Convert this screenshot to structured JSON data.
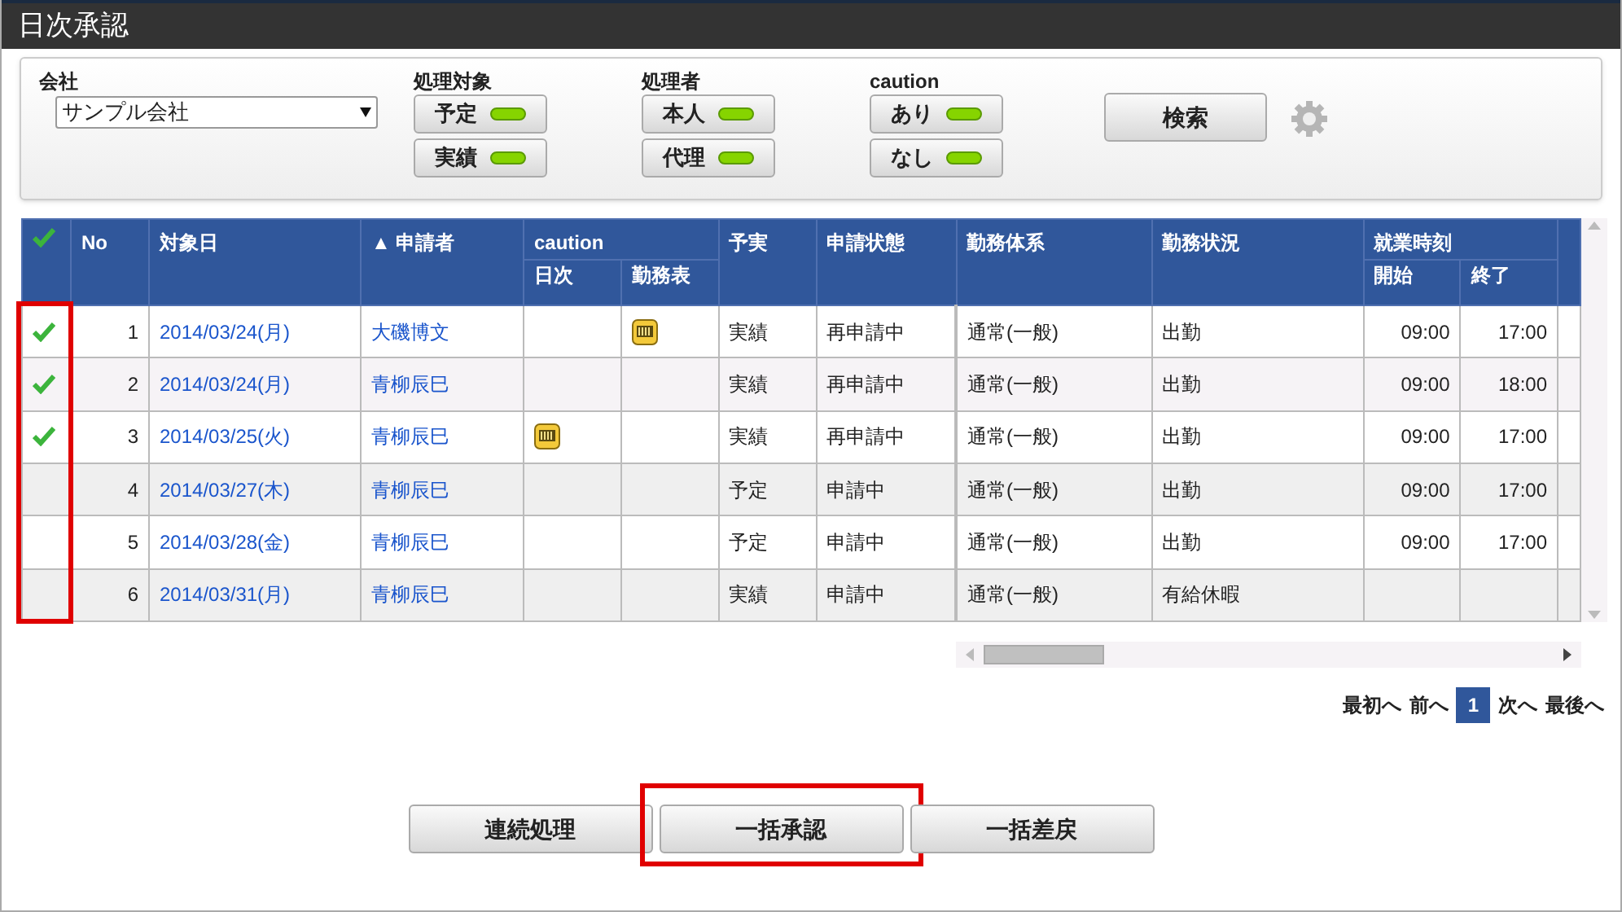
{
  "window": {
    "title": "日次承認"
  },
  "filters": {
    "company": {
      "label": "会社",
      "value": "サンプル会社"
    },
    "groups": [
      {
        "label": "処理対象",
        "toggles": [
          {
            "label": "予定",
            "on": true
          },
          {
            "label": "実績",
            "on": true
          }
        ]
      },
      {
        "label": "処理者",
        "toggles": [
          {
            "label": "本人",
            "on": true
          },
          {
            "label": "代理",
            "on": true
          }
        ]
      },
      {
        "label": "caution",
        "toggles": [
          {
            "label": "あり",
            "on": true
          },
          {
            "label": "なし",
            "on": true
          }
        ]
      }
    ],
    "search_button": "検索"
  },
  "table": {
    "select_column_highlighted": true,
    "columns": {
      "no": "No",
      "date": "対象日",
      "sort_mark": "▲",
      "applicant": "申請者",
      "caution": "caution",
      "caution_daily": "日次",
      "caution_sheet": "勤務表",
      "plan_actual": "予実",
      "status": "申請状態",
      "work_system": "勤務体系",
      "work_state": "勤務状況",
      "work_time": "就業時刻",
      "start": "開始",
      "end": "終了"
    },
    "rows": [
      {
        "checked": true,
        "no": "1",
        "date": "2014/03/24(月)",
        "applicant": "大磯博文",
        "daily_caution": false,
        "sheet_caution": true,
        "plan_actual": "実績",
        "status": "再申請中",
        "work_system": "通常(一般)",
        "work_state": "出勤",
        "start": "09:00",
        "end": "17:00"
      },
      {
        "checked": true,
        "no": "2",
        "date": "2014/03/24(月)",
        "applicant": "青柳辰巳",
        "daily_caution": false,
        "sheet_caution": false,
        "plan_actual": "実績",
        "status": "再申請中",
        "work_system": "通常(一般)",
        "work_state": "出勤",
        "start": "09:00",
        "end": "18:00"
      },
      {
        "checked": true,
        "no": "3",
        "date": "2014/03/25(火)",
        "applicant": "青柳辰巳",
        "daily_caution": true,
        "sheet_caution": false,
        "plan_actual": "実績",
        "status": "再申請中",
        "work_system": "通常(一般)",
        "work_state": "出勤",
        "start": "09:00",
        "end": "17:00"
      },
      {
        "checked": false,
        "no": "4",
        "date": "2014/03/27(木)",
        "applicant": "青柳辰巳",
        "daily_caution": false,
        "sheet_caution": false,
        "plan_actual": "予定",
        "status": "申請中",
        "work_system": "通常(一般)",
        "work_state": "出勤",
        "start": "09:00",
        "end": "17:00"
      },
      {
        "checked": false,
        "no": "5",
        "date": "2014/03/28(金)",
        "applicant": "青柳辰巳",
        "daily_caution": false,
        "sheet_caution": false,
        "plan_actual": "予定",
        "status": "申請中",
        "work_system": "通常(一般)",
        "work_state": "出勤",
        "start": "09:00",
        "end": "17:00"
      },
      {
        "checked": false,
        "no": "6",
        "date": "2014/03/31(月)",
        "applicant": "青柳辰巳",
        "daily_caution": false,
        "sheet_caution": false,
        "plan_actual": "実績",
        "status": "申請中",
        "work_system": "通常(一般)",
        "work_state": "有給休暇",
        "start": "",
        "end": ""
      }
    ]
  },
  "pagination": {
    "first": "最初へ",
    "prev": "前へ",
    "pages": [
      {
        "label": "1",
        "selected": true
      }
    ],
    "next": "次へ",
    "last": "最後へ"
  },
  "actions": [
    {
      "label": "連続処理",
      "highlighted": false
    },
    {
      "label": "一括承認",
      "highlighted": true
    },
    {
      "label": "一括差戻",
      "highlighted": false
    }
  ]
}
